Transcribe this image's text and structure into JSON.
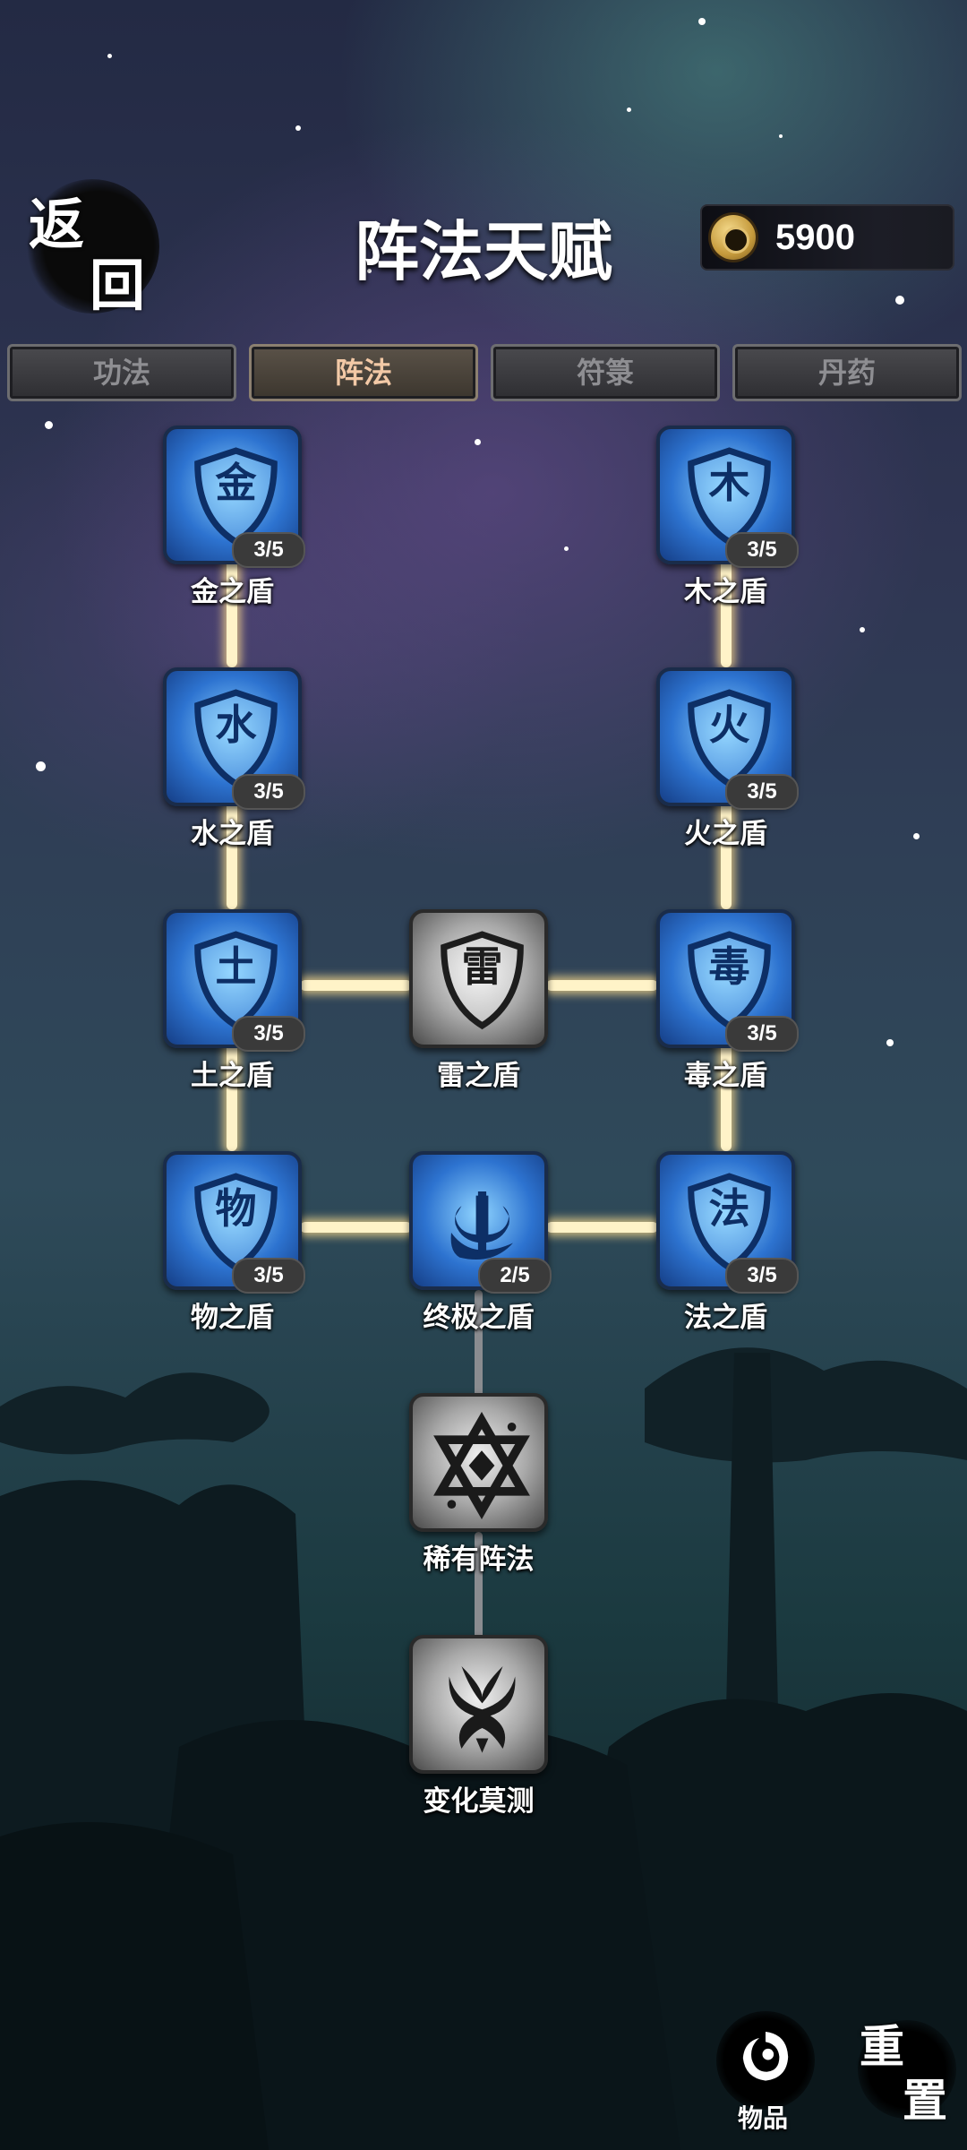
{
  "header": {
    "back_char_1": "返",
    "back_char_2": "回",
    "title": "阵法天赋",
    "currency_value": "5900",
    "currency_icon": "coin-icon"
  },
  "tabs": [
    {
      "label": "功法",
      "active": false
    },
    {
      "label": "阵法",
      "active": true
    },
    {
      "label": "符箓",
      "active": false
    },
    {
      "label": "丹药",
      "active": false
    }
  ],
  "nodes": {
    "jin": {
      "glyph": "金",
      "label": "金之盾",
      "level": "3/5"
    },
    "mu": {
      "glyph": "木",
      "label": "木之盾",
      "level": "3/5"
    },
    "shui": {
      "glyph": "水",
      "label": "水之盾",
      "level": "3/5"
    },
    "huo": {
      "glyph": "火",
      "label": "火之盾",
      "level": "3/5"
    },
    "tu": {
      "glyph": "土",
      "label": "土之盾",
      "level": "3/5"
    },
    "lei": {
      "glyph": "雷",
      "label": "雷之盾"
    },
    "du": {
      "glyph": "毒",
      "label": "毒之盾",
      "level": "3/5"
    },
    "wu": {
      "glyph": "物",
      "label": "物之盾",
      "level": "3/5"
    },
    "zhongji": {
      "label": "终极之盾",
      "level": "2/5",
      "icon": "trident-icon"
    },
    "fa": {
      "glyph": "法",
      "label": "法之盾",
      "level": "3/5"
    },
    "xiyou": {
      "label": "稀有阵法",
      "icon": "hexagram-icon"
    },
    "bianhua": {
      "label": "变化莫测",
      "icon": "rune-icon"
    }
  },
  "footer": {
    "items_label": "物品",
    "reset_char_1": "重",
    "reset_char_2": "置"
  },
  "colors": {
    "node_blue": "#2d73d0",
    "node_gray": "#a8a8a8",
    "link_lit": "#fff3c8",
    "tab_active_text": "#f3c9a6"
  }
}
